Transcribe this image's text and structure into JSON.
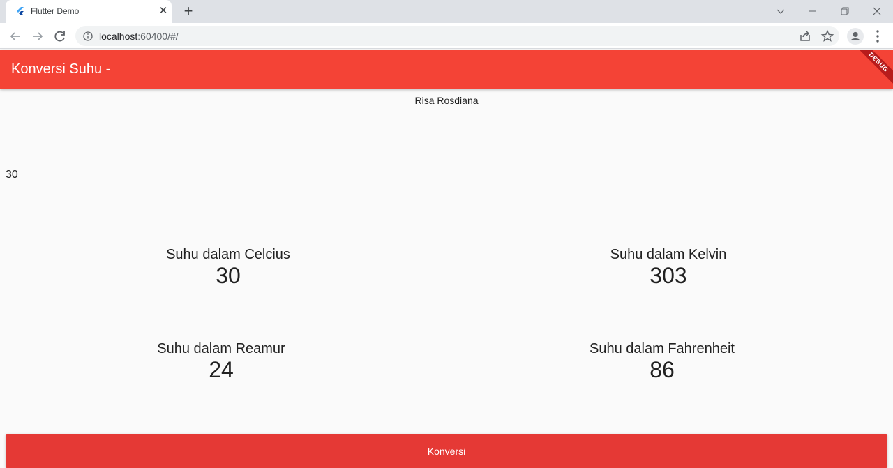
{
  "browser": {
    "tab_title": "Flutter Demo",
    "url_host": "localhost",
    "url_rest": ":60400/#/"
  },
  "app": {
    "title": "Konversi Suhu -",
    "debug_label": "DEBUG",
    "author": "Risa Rosdiana",
    "input_value": "30",
    "results": {
      "celcius": {
        "label": "Suhu dalam Celcius",
        "value": "30"
      },
      "kelvin": {
        "label": "Suhu dalam Kelvin",
        "value": "303"
      },
      "reamur": {
        "label": "Suhu dalam Reamur",
        "value": "24"
      },
      "fahrenheit": {
        "label": "Suhu dalam Fahrenheit",
        "value": "86"
      }
    },
    "button_label": "Konversi"
  },
  "colors": {
    "app_bar": "#f44336",
    "button": "#e53935"
  }
}
